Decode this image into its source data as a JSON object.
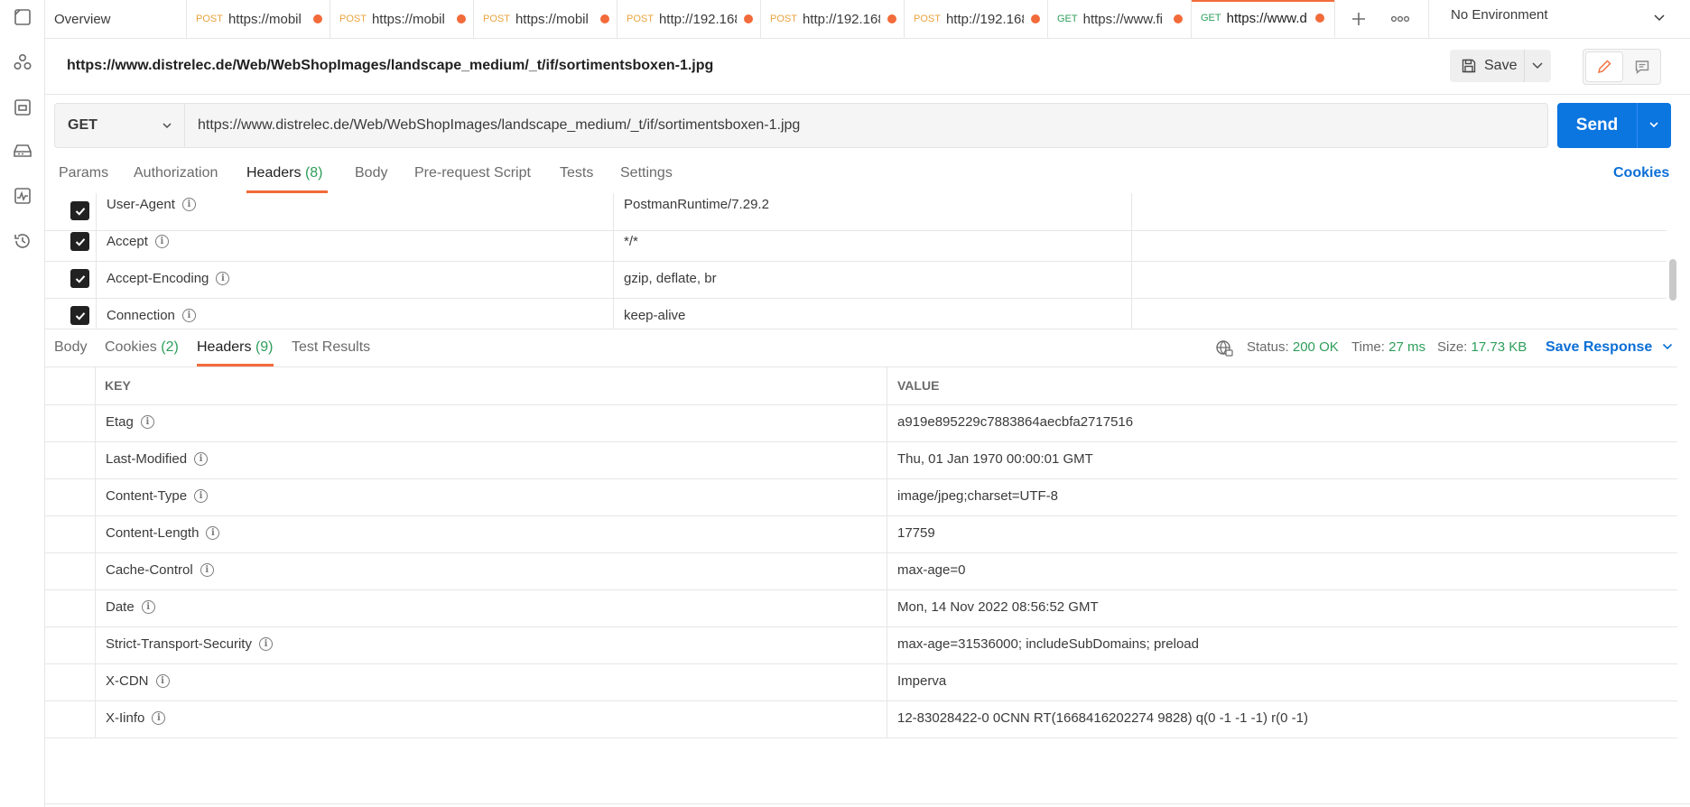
{
  "colors": {
    "accent": "#f26b3a",
    "send": "#0b75e0",
    "link": "#0b6fd6",
    "status_green": "#2e9e5b",
    "post_method": "#e8a33d"
  },
  "sidebar": {
    "icons": [
      "collections-icon",
      "apis-icon",
      "environments-icon",
      "mock-servers-icon",
      "monitors-icon",
      "history-icon"
    ]
  },
  "tabs": [
    {
      "method": "",
      "label": "Overview",
      "dot": false
    },
    {
      "method": "POST",
      "label": "https://mobil",
      "dot": true
    },
    {
      "method": "POST",
      "label": "https://mobil",
      "dot": true
    },
    {
      "method": "POST",
      "label": "https://mobil",
      "dot": true
    },
    {
      "method": "POST",
      "label": "http://192.168",
      "dot": true
    },
    {
      "method": "POST",
      "label": "http://192.168",
      "dot": true
    },
    {
      "method": "POST",
      "label": "http://192.168",
      "dot": true
    },
    {
      "method": "GET",
      "label": "https://www.fi",
      "dot": true
    },
    {
      "method": "GET",
      "label": "https://www.d",
      "dot": true
    }
  ],
  "environment": {
    "label": "No Environment"
  },
  "request": {
    "title": "https://www.distrelec.de/Web/WebShopImages/landscape_medium/_t/if/sortimentsboxen-1.jpg",
    "save_label": "Save",
    "method": "GET",
    "url": "https://www.distrelec.de/Web/WebShopImages/landscape_medium/_t/if/sortimentsboxen-1.jpg",
    "send_label": "Send",
    "tabs": {
      "params": "Params",
      "authorization": "Authorization",
      "headers": "Headers",
      "headers_count": "(8)",
      "body": "Body",
      "prerequest": "Pre-request Script",
      "tests": "Tests",
      "settings": "Settings"
    },
    "cookies_label": "Cookies",
    "headers": [
      {
        "key": "User-Agent",
        "value": "PostmanRuntime/7.29.2",
        "checked": true
      },
      {
        "key": "Accept",
        "value": "*/*",
        "checked": true
      },
      {
        "key": "Accept-Encoding",
        "value": "gzip, deflate, br",
        "checked": true
      },
      {
        "key": "Connection",
        "value": "keep-alive",
        "checked": true
      }
    ]
  },
  "response": {
    "tabs": {
      "body": "Body",
      "cookies": "Cookies",
      "cookies_count": "(2)",
      "headers": "Headers",
      "headers_count": "(9)",
      "test_results": "Test Results"
    },
    "status_label": "Status:",
    "status_value": "200 OK",
    "time_label": "Time:",
    "time_value": "27 ms",
    "size_label": "Size:",
    "size_value": "17.73 KB",
    "save_response_label": "Save Response",
    "table_key_header": "KEY",
    "table_value_header": "VALUE",
    "headers": [
      {
        "key": "Etag",
        "value": "a919e895229c7883864aecbfa2717516"
      },
      {
        "key": "Last-Modified",
        "value": "Thu, 01 Jan 1970 00:00:01 GMT"
      },
      {
        "key": "Content-Type",
        "value": "image/jpeg;charset=UTF-8"
      },
      {
        "key": "Content-Length",
        "value": "17759"
      },
      {
        "key": "Cache-Control",
        "value": "max-age=0"
      },
      {
        "key": "Date",
        "value": "Mon, 14 Nov 2022 08:56:52 GMT"
      },
      {
        "key": "Strict-Transport-Security",
        "value": "max-age=31536000; includeSubDomains; preload"
      },
      {
        "key": "X-CDN",
        "value": "Imperva"
      },
      {
        "key": "X-Iinfo",
        "value": "12-83028422-0 0CNN RT(1668416202274 9828) q(0 -1 -1 -1) r(0 -1)"
      }
    ]
  }
}
